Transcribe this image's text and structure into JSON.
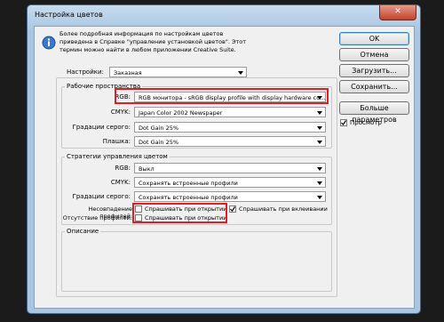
{
  "window": {
    "title": "Настройка цветов",
    "close_label": "✕"
  },
  "info": {
    "line1": "Более подробная информация по настройкам цветов",
    "line2": "приведена в Справке \"управление установкой цветов\". Этот",
    "line3": "термин можно найти в любом приложении Creative Suite."
  },
  "settings": {
    "label": "Настройки:",
    "value": "Заказная"
  },
  "working_spaces": {
    "title": "Рабочие пространства",
    "rgb_label": "RGB:",
    "rgb_value": "RGB монитора - sRGB display profile with display hardware co...",
    "cmyk_label": "CMYK:",
    "cmyk_value": "Japan Color 2002 Newspaper",
    "gray_label": "Градации серого:",
    "gray_value": "Dot Gain 25%",
    "spot_label": "Плашка:",
    "spot_value": "Dot Gain 25%"
  },
  "policies": {
    "title": "Стратегии управления цветом",
    "rgb_label": "RGB:",
    "rgb_value": "Выкл",
    "cmyk_label": "CMYK:",
    "cmyk_value": "Сохранять встроенные профили",
    "gray_label": "Градации серого:",
    "gray_value": "Сохранять встроенные профили",
    "mismatch_label": "Несовпадение профилей:",
    "mismatch_open": "Спрашивать при открытии",
    "mismatch_paste": "Спрашивать при вклеивании",
    "missing_label": "Отсутствие профилей:",
    "missing_open": "Спрашивать при открытии"
  },
  "description": {
    "title": "Описание"
  },
  "buttons": {
    "ok": "OK",
    "cancel": "Отмена",
    "load": "Загрузить...",
    "save": "Сохранить...",
    "more": "Больше параметров",
    "preview": "Просмотр"
  },
  "checks": {
    "mismatch_open": false,
    "mismatch_paste": true,
    "missing_open": false,
    "preview": true
  },
  "colors": {
    "highlight": "#e01e24"
  }
}
